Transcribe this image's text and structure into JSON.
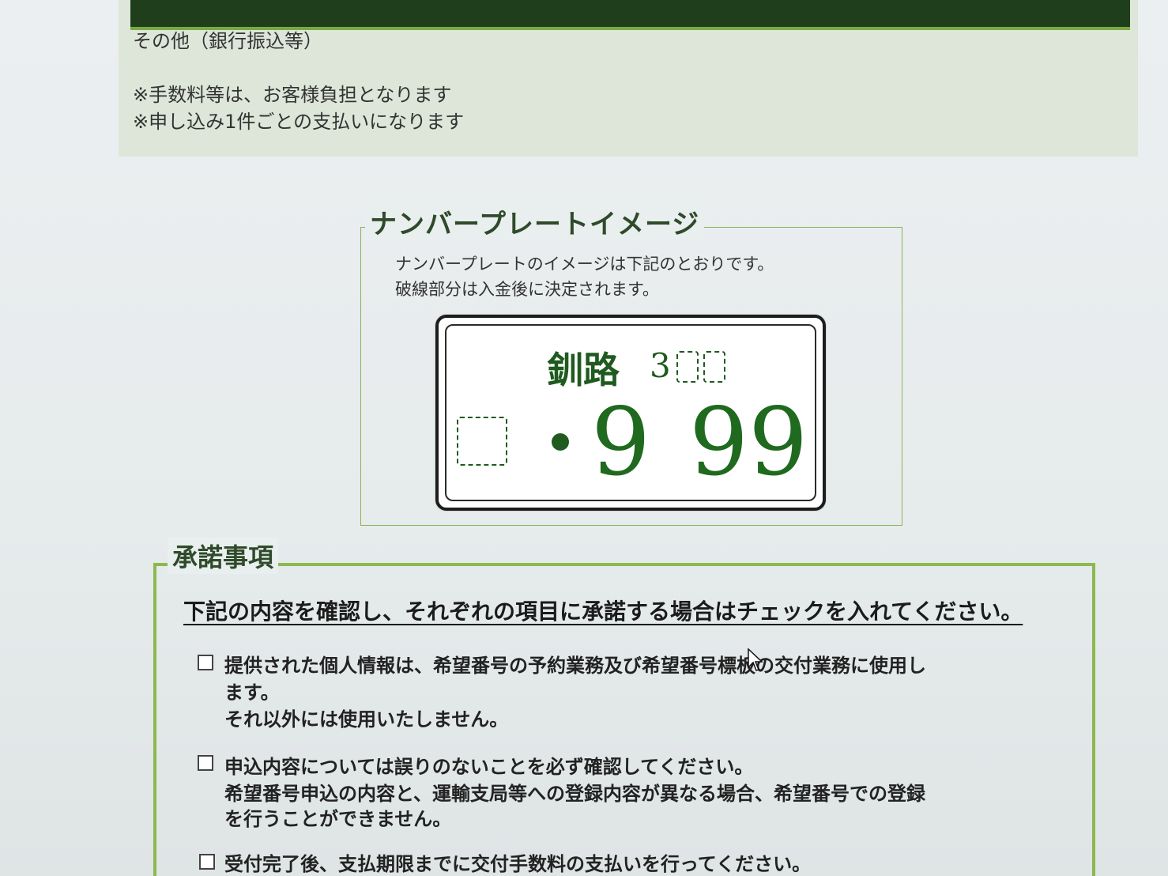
{
  "payment": {
    "method_other": "その他（銀行振込等）",
    "note_fee": "※手数料等は、お客様負担となります",
    "note_per_application": "※申し込み1件ごとの支払いになります"
  },
  "plate_section": {
    "title": "ナンバープレートイメージ",
    "desc_line1": "ナンバープレートのイメージは下記のとおりです。",
    "desc_line2": "破線部分は入金後に決定されます。",
    "plate": {
      "region": "釧路",
      "class_prefix": "3",
      "dot": "・",
      "digit_1": "9",
      "digits_34": "99",
      "text_color": "#1f6a1f"
    }
  },
  "consent_section": {
    "title": "承諾事項",
    "instruction": "下記の内容を確認し、それぞれの項目に承諾する場合はチェックを入れてください。",
    "items": [
      {
        "checked": false,
        "line1": "提供された個人情報は、希望番号の予約業務及び希望番号標板の交付業務に使用し",
        "line2": "ます。",
        "line3": "それ以外には使用いたしません。"
      },
      {
        "checked": false,
        "line1": "申込内容については誤りのないことを必ず確認してください。",
        "line2": "希望番号申込の内容と、運輸支局等への登録内容が異なる場合、希望番号での登録",
        "line3": "を行うことができません。"
      },
      {
        "checked": false,
        "line1": "受付完了後、支払期限までに交付手数料の支払いを行ってください。"
      }
    ]
  },
  "colors": {
    "accent_green": "#8cb84e",
    "dark_bar": "#1f3f1c",
    "plate_green": "#1f5a1f"
  },
  "icons": {
    "cursor": "mouse-pointer-icon",
    "checkbox": "checkbox-empty-icon"
  }
}
